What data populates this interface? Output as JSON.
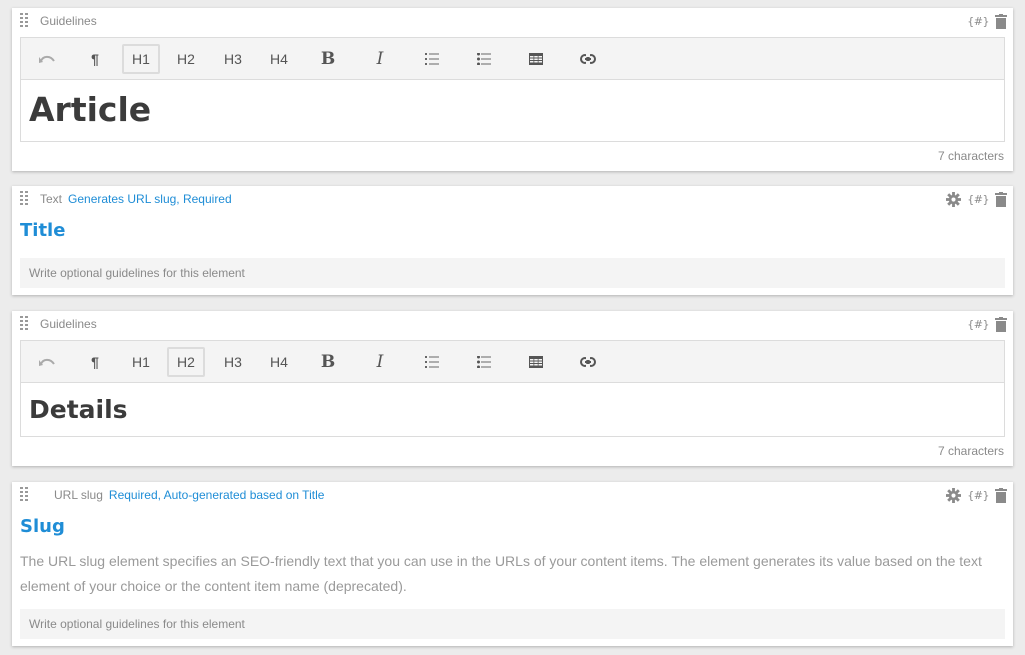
{
  "cards": [
    {
      "type": "Guidelines",
      "toolbar": {
        "undo": "↶",
        "paragraph": "¶",
        "h1": "H1",
        "h2": "H2",
        "h3": "H3",
        "h4": "H4",
        "bold": "B",
        "italic": "I",
        "active": "H1"
      },
      "content": "Article",
      "char_count": "7 characters",
      "macro_label": "{#}"
    },
    {
      "type": "Text",
      "flags": "Generates URL slug, Required",
      "title": "Title",
      "guidelines_placeholder": "Write optional guidelines for this element",
      "macro_label": "{#}"
    },
    {
      "type": "Guidelines",
      "toolbar": {
        "undo": "↶",
        "paragraph": "¶",
        "h1": "H1",
        "h2": "H2",
        "h3": "H3",
        "h4": "H4",
        "bold": "B",
        "italic": "I",
        "active": "H2"
      },
      "content": "Details",
      "char_count": "7 characters",
      "macro_label": "{#}"
    },
    {
      "type": "URL slug",
      "flags": "Required, Auto-generated based on Title",
      "title": "Slug",
      "description": "The URL slug element specifies an SEO-friendly text that you can use in the URLs of your content items. The element generates its value based on the text element of your choice or the content item name (deprecated).",
      "guidelines_placeholder": "Write optional guidelines for this element",
      "macro_label": "{#}"
    }
  ],
  "colors": {
    "accent": "#1f8dd6",
    "muted": "#8a8a8a",
    "background": "#ececec"
  }
}
